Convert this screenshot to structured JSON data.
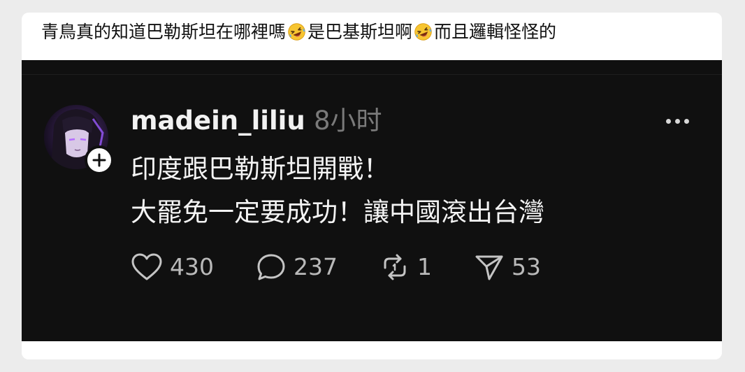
{
  "caption": {
    "part1": "青鳥真的知道巴勒斯坦在哪裡嗎",
    "part2": "是巴基斯坦啊",
    "part3": "而且邏輯怪怪的",
    "emoji_icon": "rolling-on-floor-laughing-emoji"
  },
  "post": {
    "username": "madein_liliu",
    "timestamp": "8小时",
    "line1": "印度跟巴勒斯坦開戰！",
    "line2": "大罷免一定要成功！讓中國滾出台灣",
    "more_icon": "ellipsis-icon",
    "follow_icon": "plus-icon"
  },
  "actions": {
    "likes": "430",
    "replies": "237",
    "reposts": "1",
    "shares": "53"
  },
  "colors": {
    "background": "#101010",
    "text": "#f4f4f4",
    "muted": "#7a7a7a",
    "emoji": "#f7c531"
  }
}
